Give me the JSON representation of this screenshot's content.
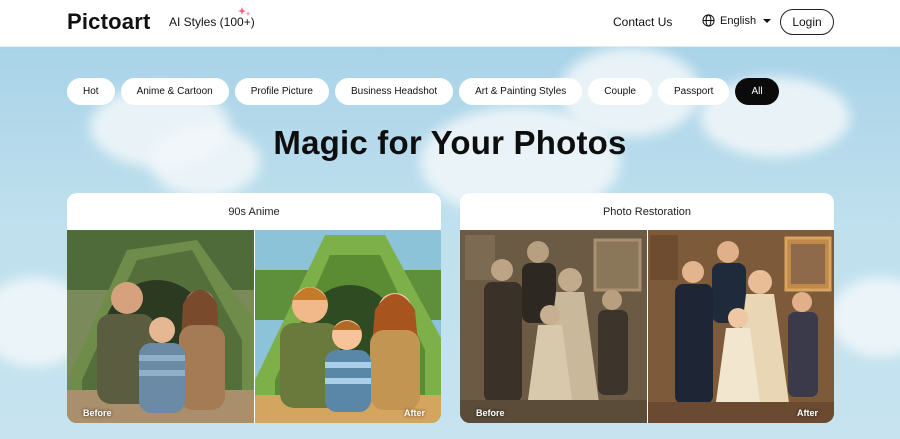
{
  "header": {
    "logo": "Pictoart",
    "ai_styles": "AI Styles (100+)",
    "contact": "Contact Us",
    "language": "English",
    "login": "Login"
  },
  "tabs": [
    {
      "label": "Hot"
    },
    {
      "label": "Anime & Cartoon"
    },
    {
      "label": "Profile Picture"
    },
    {
      "label": "Business Headshot"
    },
    {
      "label": "Art & Painting Styles"
    },
    {
      "label": "Couple"
    },
    {
      "label": "Passport"
    },
    {
      "label": "All",
      "active": true
    }
  ],
  "headline": "Magic for Your Photos",
  "cards": [
    {
      "title": "90s Anime",
      "before": "Before",
      "after": "After"
    },
    {
      "title": "Photo Restoration",
      "before": "Before",
      "after": "After"
    }
  ],
  "colors": {
    "accent": "#0b0b0b",
    "sparkle": "#ff5a7a",
    "sky": "#b9dcec"
  }
}
